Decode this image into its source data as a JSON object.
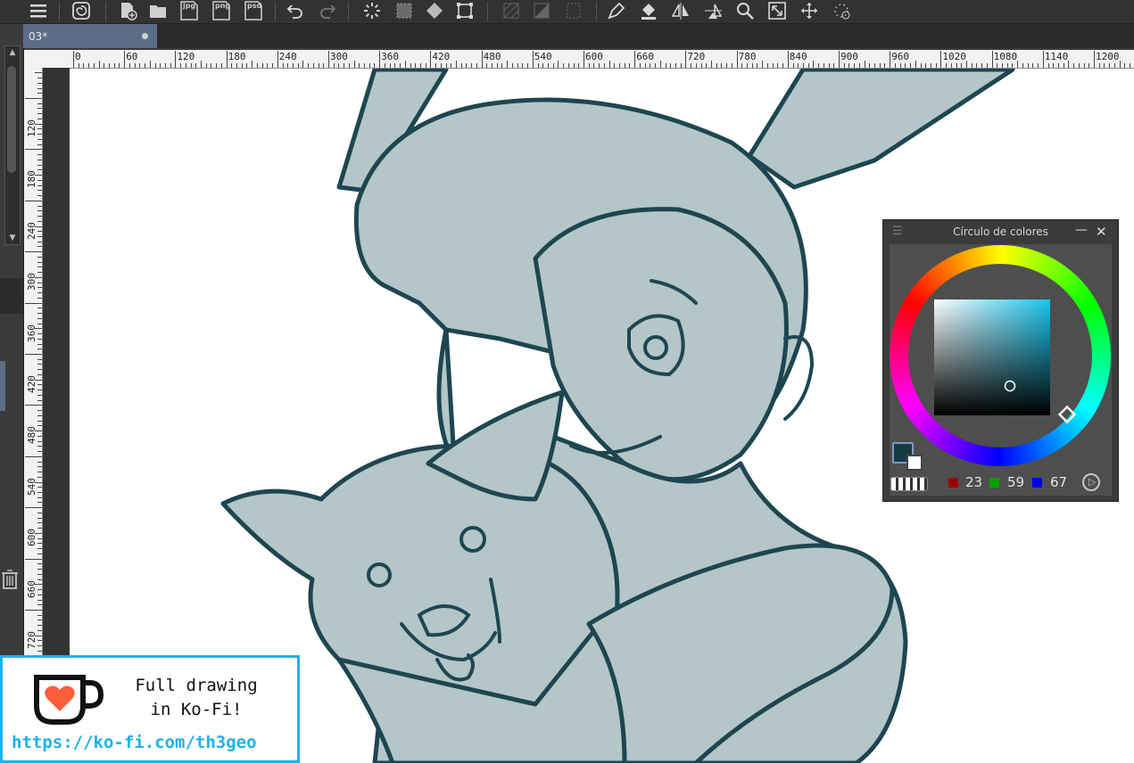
{
  "toolbar": {
    "menu_icon": "hamburger-icon",
    "file_buttons": [
      "jpg",
      "png",
      "psd"
    ]
  },
  "document_tab": {
    "label": "03*"
  },
  "rulers": {
    "horizontal": [
      "0",
      "60",
      "120",
      "180",
      "240",
      "300",
      "360",
      "420",
      "480",
      "540",
      "600",
      "660",
      "720",
      "780",
      "840",
      "900",
      "960",
      "1020",
      "1080",
      "1140",
      "1200"
    ],
    "vertical": [
      "120",
      "180",
      "240",
      "300",
      "360",
      "420",
      "480",
      "540",
      "600",
      "660",
      "720",
      "780"
    ]
  },
  "color_panel": {
    "title": "Círculo de colores",
    "rgb": {
      "r": "23",
      "g": "59",
      "b": "67"
    },
    "main_color": "#173b43",
    "sub_color": "#ffffff"
  },
  "kofi": {
    "line1": "Full drawing",
    "line2": "in Ko-Fi!",
    "url": "https://ko-fi.com/th3geo",
    "accent": "#1fb2ea",
    "heart": "#ff5e3a"
  },
  "artwork": {
    "line_color": "#1e4650",
    "fill_color": "#b4c6c8"
  }
}
